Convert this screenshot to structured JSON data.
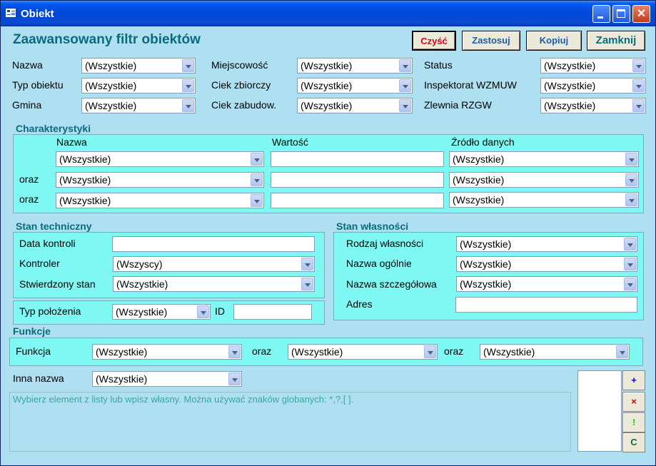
{
  "window": {
    "title": "Obiekt"
  },
  "heading": "Zaawansowany filtr obiektów",
  "buttons": {
    "clear": "Czyść",
    "apply": "Zastosuj",
    "copy": "Kopiuj",
    "close": "Zamknij"
  },
  "filters": {
    "nazwa": {
      "label": "Nazwa",
      "value": "(Wszystkie)"
    },
    "typ_obiektu": {
      "label": "Typ obiektu",
      "value": "(Wszystkie)"
    },
    "gmina": {
      "label": "Gmina",
      "value": "(Wszystkie)"
    },
    "miejscowosc": {
      "label": "Miejscowość",
      "value": "(Wszystkie)"
    },
    "ciek_zbiorczy": {
      "label": "Ciek zbiorczy",
      "value": "(Wszystkie)"
    },
    "ciek_zabudow": {
      "label": "Ciek zabudow.",
      "value": "(Wszystkie)"
    },
    "status": {
      "label": "Status",
      "value": "(Wszystkie)"
    },
    "inspektorat": {
      "label": "Inspektorat WZMUW",
      "value": "(Wszystkie)"
    },
    "zlewnia": {
      "label": "Zlewnia RZGW",
      "value": "(Wszystkie)"
    }
  },
  "charakterystyki": {
    "title": "Charakterystyki",
    "col_nazwa": "Nazwa",
    "col_wartosc": "Wartość",
    "col_zrodlo": "Źródło danych",
    "oraz": "oraz",
    "rows": [
      {
        "nazwa": "(Wszystkie)",
        "zrodlo": "(Wszystkie)"
      },
      {
        "nazwa": "(Wszystkie)",
        "zrodlo": "(Wszystkie)"
      },
      {
        "nazwa": "(Wszystkie)",
        "zrodlo": "(Wszystkie)"
      }
    ]
  },
  "stan_techniczny": {
    "title": "Stan techniczny",
    "data_kontroli": "Data kontroli",
    "kontroler": "Kontroler",
    "kontroler_value": "(Wszyscy)",
    "stwierdzony": "Stwierdzony stan",
    "stwierdzony_value": "(Wszystkie)"
  },
  "polozenie": {
    "label": "Typ położenia",
    "value": "(Wszystkie)",
    "id_label": "ID"
  },
  "stan_wlasnosci": {
    "title": "Stan własności",
    "rodzaj": "Rodzaj własności",
    "rodzaj_value": "(Wszystkie)",
    "nazwa_ogolnie": "Nazwa ogólnie",
    "nazwa_ogolnie_value": "(Wszystkie)",
    "nazwa_szczeg": "Nazwa szczegółowa",
    "nazwa_szczeg_value": "(Wszystkie)",
    "adres": "Adres"
  },
  "funkcje": {
    "title": "Funkcje",
    "label": "Funkcja",
    "oraz": "oraz",
    "values": [
      "(Wszystkie)",
      "(Wszystkie)",
      "(Wszystkie)"
    ]
  },
  "inna_nazwa": {
    "label": "Inna nazwa",
    "value": "(Wszystkie)"
  },
  "hint": "Wybierz element z listy lub wpisz własny. Można używać znaków globanych: *,?,[ ].",
  "side_buttons": [
    "+",
    "×",
    "!",
    "C"
  ],
  "colors": {
    "background": "#aee0f2",
    "panel": "#7ff8f4",
    "heading": "#0a6b7e"
  }
}
